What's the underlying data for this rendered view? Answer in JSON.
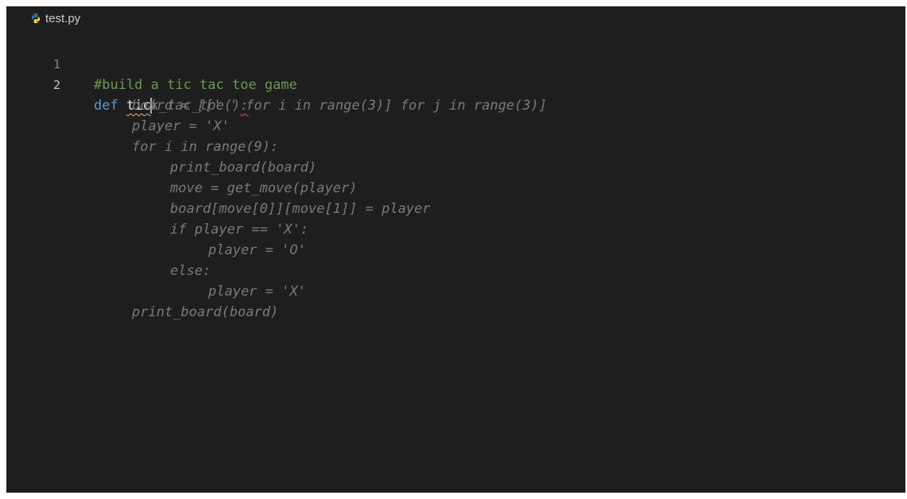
{
  "tab": {
    "filename": "test.py",
    "icon": "python-icon"
  },
  "editor": {
    "line_numbers": [
      "1",
      "2"
    ],
    "line1": {
      "comment": "#build a tic tac toe game"
    },
    "line2": {
      "keyword": "def",
      "typed": "tic",
      "ghost_suffix": "k_tac_toe()",
      "ghost_colon": ":"
    },
    "suggestion_lines": [
      "board = [[' ' for i in range(3)] for j in range(3)]",
      "player = 'X'",
      "for i in range(9):",
      "print_board(board)",
      "move = get_move(player)",
      "board[move[0]][move[1]] = player",
      "if player == 'X':",
      "player = 'O'",
      "else:",
      "player = 'X'",
      "print_board(board)"
    ]
  },
  "colors": {
    "background": "#1e1e1e",
    "comment": "#6a9955",
    "keyword": "#569cd6",
    "ghost_text": "#7a7a7a",
    "line_number": "#858585",
    "python_icon_blue": "#3572a5",
    "python_icon_yellow": "#ffd43b"
  }
}
